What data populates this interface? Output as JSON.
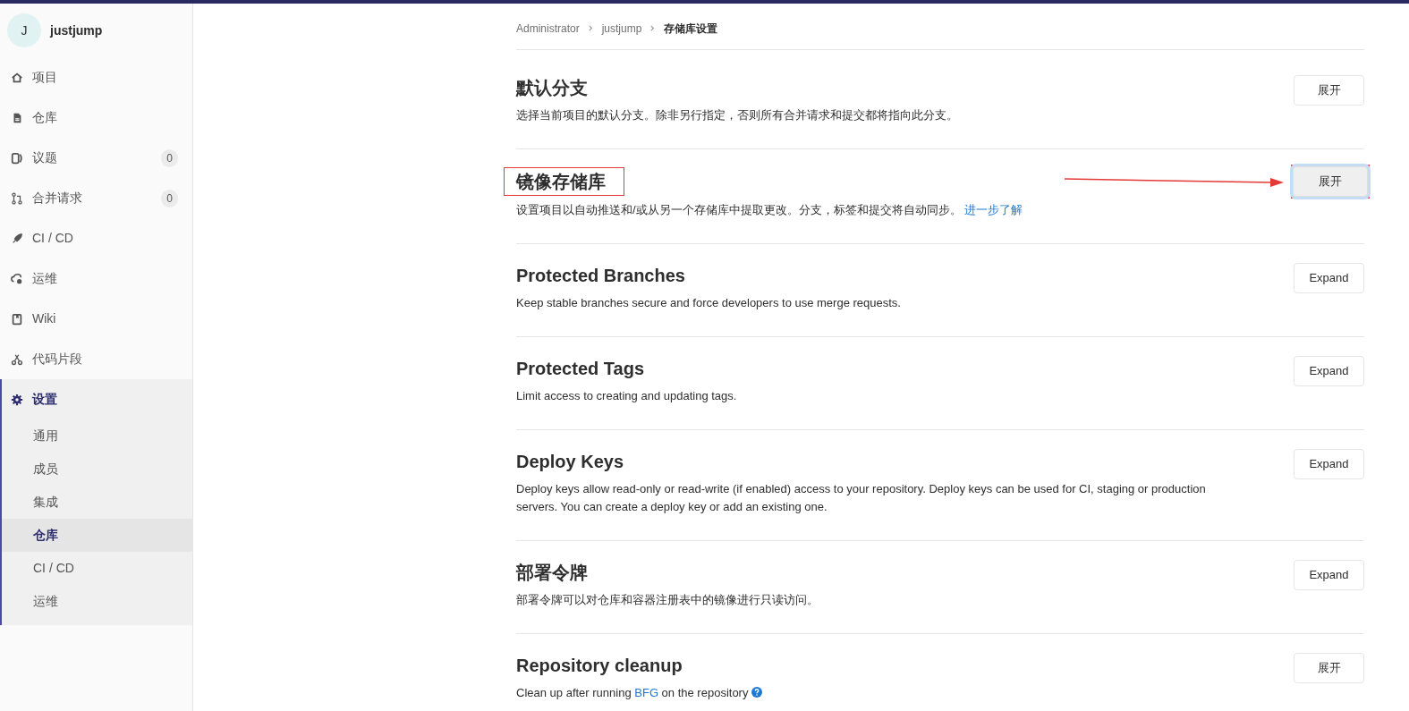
{
  "sidebar": {
    "project": {
      "avatar": "J",
      "name": "justjump"
    },
    "items": [
      {
        "label": "项目",
        "selected": false
      },
      {
        "label": "仓库",
        "selected": false
      },
      {
        "label": "议题",
        "count": "0",
        "selected": false
      },
      {
        "label": "合并请求",
        "count": "0",
        "selected": false
      },
      {
        "label": "CI / CD",
        "selected": false
      },
      {
        "label": "运维",
        "selected": false
      },
      {
        "label": "Wiki",
        "selected": false
      },
      {
        "label": "代码片段",
        "selected": false
      },
      {
        "label": "设置",
        "selected": true,
        "children": [
          {
            "label": "通用",
            "selected": false
          },
          {
            "label": "成员",
            "selected": false
          },
          {
            "label": "集成",
            "selected": false
          },
          {
            "label": "仓库",
            "selected": true
          },
          {
            "label": "CI / CD",
            "selected": false
          },
          {
            "label": "运维",
            "selected": false
          }
        ]
      }
    ]
  },
  "breadcrumb": [
    "Administrator",
    "justjump",
    "存储库设置"
  ],
  "sections": [
    {
      "title": "默认分支",
      "description": [
        {
          "kind": "text",
          "text": "选择当前项目的默认分支。除非另行指定，否则所有合并请求和提交都将指向此分支。"
        }
      ],
      "button": "展开",
      "focused": false,
      "annotated": false
    },
    {
      "title": "镜像存储库",
      "description": [
        {
          "kind": "text",
          "text": "设置项目以自动推送和/或从另一个存储库中提取更改。分支，标签和提交将自动同步。 "
        },
        {
          "kind": "link",
          "text": "进一步了解"
        }
      ],
      "button": "展开",
      "focused": true,
      "annotated": true
    },
    {
      "title": "Protected Branches",
      "description": [
        {
          "kind": "text",
          "text": "Keep stable branches secure and force developers to use merge requests."
        }
      ],
      "button": "Expand",
      "focused": false,
      "annotated": false
    },
    {
      "title": "Protected Tags",
      "description": [
        {
          "kind": "text",
          "text": "Limit access to creating and updating tags."
        }
      ],
      "button": "Expand",
      "focused": false,
      "annotated": false
    },
    {
      "title": "Deploy Keys",
      "description": [
        {
          "kind": "text",
          "text": "Deploy keys allow read-only or read-write (if enabled) access to your repository. Deploy keys can be used for CI, staging or production servers. You can create a deploy key or add an existing one."
        }
      ],
      "button": "Expand",
      "focused": false,
      "annotated": false
    },
    {
      "title": "部署令牌",
      "description": [
        {
          "kind": "text",
          "text": "部署令牌可以对仓库和容器注册表中的镜像进行只读访问。"
        }
      ],
      "button": "Expand",
      "focused": false,
      "annotated": false
    },
    {
      "title": "Repository cleanup",
      "description": [
        {
          "kind": "text",
          "text": "Clean up after running "
        },
        {
          "kind": "link",
          "text": "BFG"
        },
        {
          "kind": "text",
          "text": " on the repository"
        }
      ],
      "help_icon": true,
      "button": "展开",
      "focused": false,
      "annotated": false
    }
  ]
}
